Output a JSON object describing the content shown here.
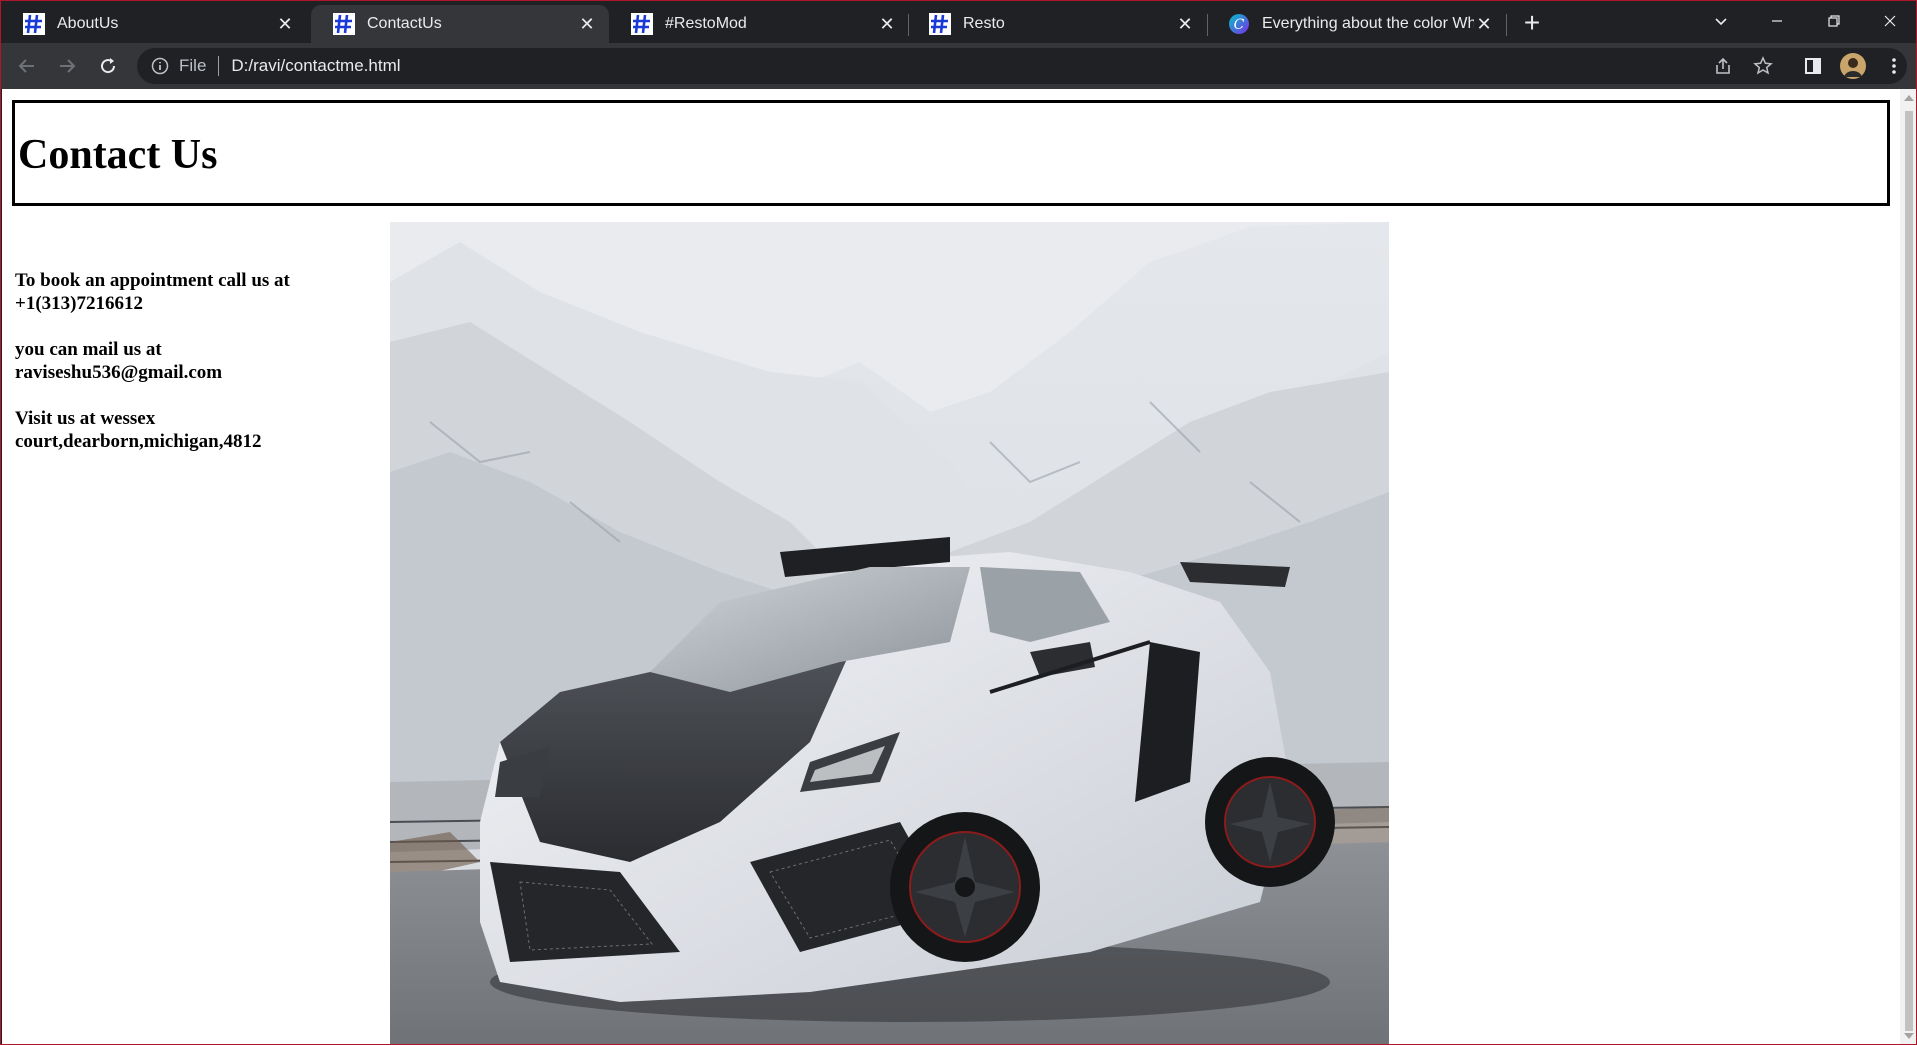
{
  "browser": {
    "tabs": [
      {
        "label": "AboutUs",
        "favicon": "hash-icon",
        "active": false
      },
      {
        "label": "ContactUs",
        "favicon": "hash-icon",
        "active": true
      },
      {
        "label": "#RestoMod",
        "favicon": "hash-icon",
        "active": false
      },
      {
        "label": "Resto",
        "favicon": "hash-icon",
        "active": false
      },
      {
        "label": "Everything about the color White",
        "favicon": "canva-icon",
        "active": false
      }
    ],
    "address_scheme": "File",
    "address_url": "D:/ravi/contactme.html",
    "accent_color": "#202124"
  },
  "page": {
    "title": "Contact Us",
    "phone_line": "To book an appointment call us at",
    "phone": "+1(313)7216612",
    "mail_line": "you can mail us at",
    "email": "raviseshu536@gmail.com",
    "visit_line": "Visit us at wessex",
    "address": "court,dearborn,michigan,4812",
    "image_subject": "white sports car on snowy mountain road"
  }
}
